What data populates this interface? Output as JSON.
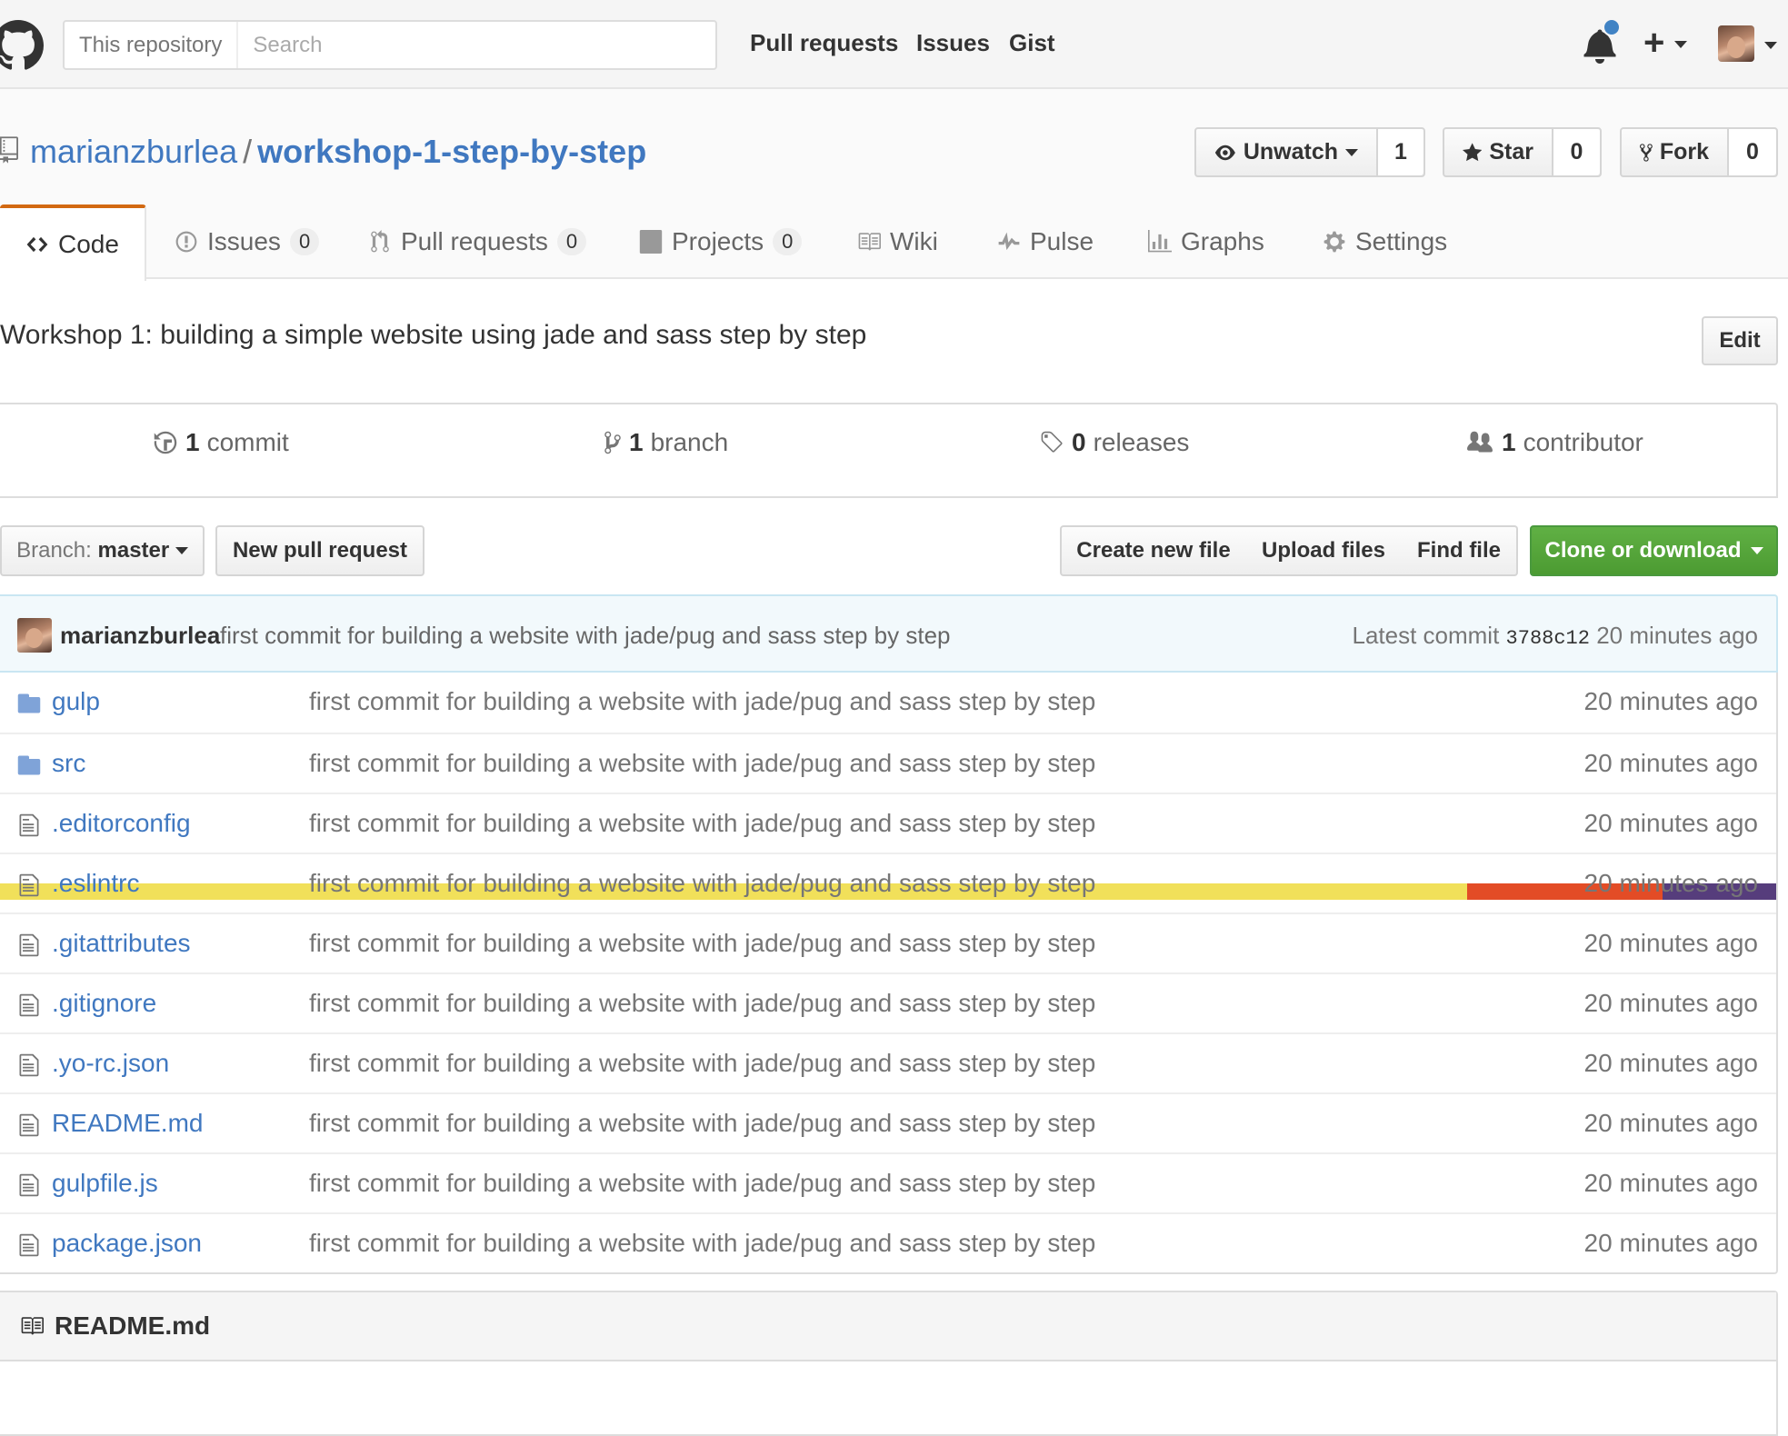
{
  "header": {
    "search_scope": "This repository",
    "search_placeholder": "Search",
    "nav": [
      "Pull requests",
      "Issues",
      "Gist"
    ]
  },
  "repo": {
    "owner": "marianzburlea",
    "separator": "/",
    "name": "workshop-1-step-by-step",
    "watch": {
      "label": "Unwatch",
      "count": "1"
    },
    "star": {
      "label": "Star",
      "count": "0"
    },
    "fork": {
      "label": "Fork",
      "count": "0"
    }
  },
  "tabs": [
    {
      "label": "Code",
      "icon": "code-icon"
    },
    {
      "label": "Issues",
      "count": "0",
      "icon": "issue-icon"
    },
    {
      "label": "Pull requests",
      "count": "0",
      "icon": "pull-request-icon"
    },
    {
      "label": "Projects",
      "count": "0",
      "icon": "project-icon"
    },
    {
      "label": "Wiki",
      "icon": "book-icon"
    },
    {
      "label": "Pulse",
      "icon": "pulse-icon"
    },
    {
      "label": "Graphs",
      "icon": "graph-icon"
    },
    {
      "label": "Settings",
      "icon": "gear-icon"
    }
  ],
  "description": "Workshop 1: building a simple website using jade and sass step by step",
  "edit_label": "Edit",
  "summary": {
    "commits": {
      "num": "1",
      "label": "commit"
    },
    "branches": {
      "num": "1",
      "label": "branch"
    },
    "releases": {
      "num": "0",
      "label": "releases"
    },
    "contributors": {
      "num": "1",
      "label": "contributor"
    }
  },
  "language_colors": [
    "#f1e05a",
    "#e34c26",
    "#563d7c"
  ],
  "file_nav": {
    "branch_prefix": "Branch:",
    "branch": "master",
    "new_pr": "New pull request",
    "create_file": "Create new file",
    "upload": "Upload files",
    "find": "Find file",
    "clone": "Clone or download"
  },
  "latest_commit": {
    "author": "marianzburlea",
    "message": "first commit for building a website with jade/pug and sass step by step",
    "prefix": "Latest commit",
    "sha": "3788c12",
    "age": "20 minutes ago"
  },
  "files": [
    {
      "name": "gulp",
      "type": "folder",
      "message": "first commit for building a website with jade/pug and sass step by step",
      "age": "20 minutes ago"
    },
    {
      "name": "src",
      "type": "folder",
      "message": "first commit for building a website with jade/pug and sass step by step",
      "age": "20 minutes ago"
    },
    {
      "name": ".editorconfig",
      "type": "file",
      "message": "first commit for building a website with jade/pug and sass step by step",
      "age": "20 minutes ago"
    },
    {
      "name": ".eslintrc",
      "type": "file",
      "message": "first commit for building a website with jade/pug and sass step by step",
      "age": "20 minutes ago"
    },
    {
      "name": ".gitattributes",
      "type": "file",
      "message": "first commit for building a website with jade/pug and sass step by step",
      "age": "20 minutes ago"
    },
    {
      "name": ".gitignore",
      "type": "file",
      "message": "first commit for building a website with jade/pug and sass step by step",
      "age": "20 minutes ago"
    },
    {
      "name": ".yo-rc.json",
      "type": "file",
      "message": "first commit for building a website with jade/pug and sass step by step",
      "age": "20 minutes ago"
    },
    {
      "name": "README.md",
      "type": "file",
      "message": "first commit for building a website with jade/pug and sass step by step",
      "age": "20 minutes ago"
    },
    {
      "name": "gulpfile.js",
      "type": "file",
      "message": "first commit for building a website with jade/pug and sass step by step",
      "age": "20 minutes ago"
    },
    {
      "name": "package.json",
      "type": "file",
      "message": "first commit for building a website with jade/pug and sass step by step",
      "age": "20 minutes ago"
    }
  ],
  "readme": {
    "title": "README.md"
  }
}
